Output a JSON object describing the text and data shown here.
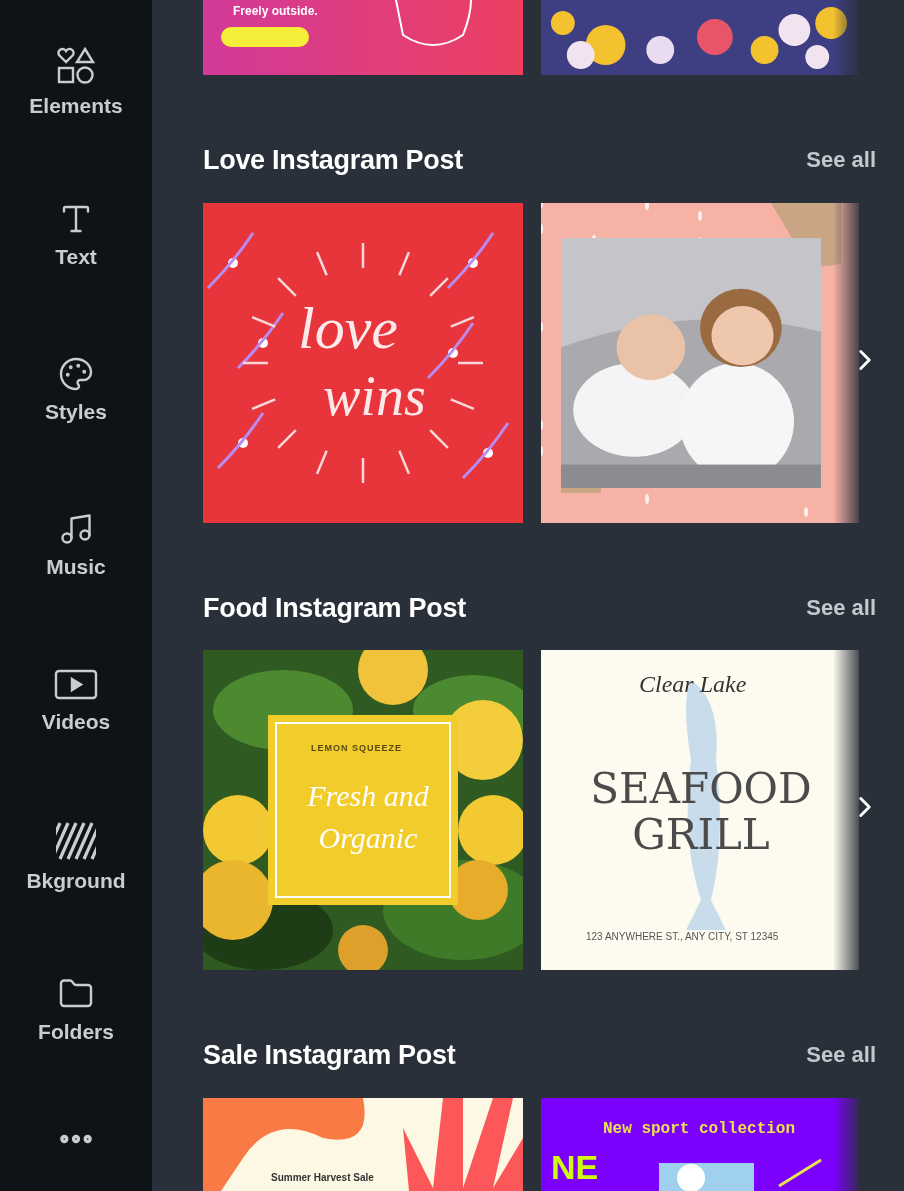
{
  "sidebar": {
    "items": [
      {
        "label": "Elements"
      },
      {
        "label": "Text"
      },
      {
        "label": "Styles"
      },
      {
        "label": "Music"
      },
      {
        "label": "Videos"
      },
      {
        "label": "Bkground"
      },
      {
        "label": "Folders"
      }
    ]
  },
  "sections": [
    {
      "templates": [
        {
          "kind": "party",
          "texts": [
            "Freely outside."
          ]
        },
        {
          "kind": "emoji"
        }
      ],
      "has_next": false
    },
    {
      "title": "Love Instagram Post",
      "see_all": "See all",
      "templates": [
        {
          "kind": "lettering",
          "texts": [
            "love",
            "wins"
          ]
        },
        {
          "kind": "photo-frame"
        }
      ],
      "has_next": true
    },
    {
      "title": "Food Instagram Post",
      "see_all": "See all",
      "templates": [
        {
          "kind": "lemon",
          "texts": [
            "LEMON SQUEEZE",
            "Fresh and Organic"
          ]
        },
        {
          "kind": "seafood",
          "texts": [
            "Clear Lake",
            "SEAFOOD GRILL",
            "123 ANYWHERE ST., ANY CITY, ST 12345"
          ]
        }
      ],
      "has_next": true
    },
    {
      "title": "Sale Instagram Post",
      "see_all": "See all",
      "templates": [
        {
          "kind": "harvest",
          "texts": [
            "Summer Harvest Sale"
          ]
        },
        {
          "kind": "sport",
          "texts": [
            "New sport collection",
            "NE"
          ]
        }
      ],
      "has_next": false
    }
  ]
}
